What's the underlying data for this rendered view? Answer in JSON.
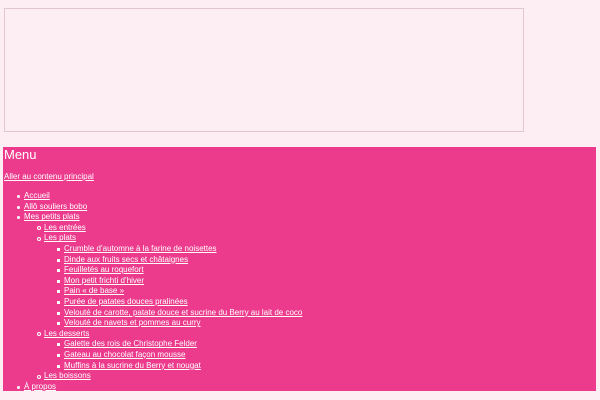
{
  "menu": {
    "title": "Menu",
    "skip_link": "Aller au contenu principal",
    "items": {
      "home": "Accueil",
      "allo": "Allô souliers bobo",
      "recipes": "Mes petits plats",
      "starters": "Les entrées",
      "mains": "Les plats",
      "mains_list": [
        "Crumble d’automne à la farine de noisettes",
        "Dinde aux fruits secs et châtaignes",
        "Feuilletés au roquefort",
        "Mon petit frichti d’hiver",
        "Pain « de base »",
        "Purée de patates douces pralinées",
        "Velouté de carotte, patate douce et sucrine du Berry au lait de coco",
        "Velouté de navets et pommes au curry"
      ],
      "desserts": "Les desserts",
      "desserts_list": [
        "Galette des rois de Christophe Felder",
        "Gateau au chocolat façon mousse",
        "Muffins à la sucrine du Berry et nougat"
      ],
      "drinks": "Les boissons",
      "about": "À propos"
    }
  },
  "colors": {
    "page_background": "#fdeef4",
    "menu_background": "#ec3b8c",
    "menu_text": "#ffffff"
  }
}
